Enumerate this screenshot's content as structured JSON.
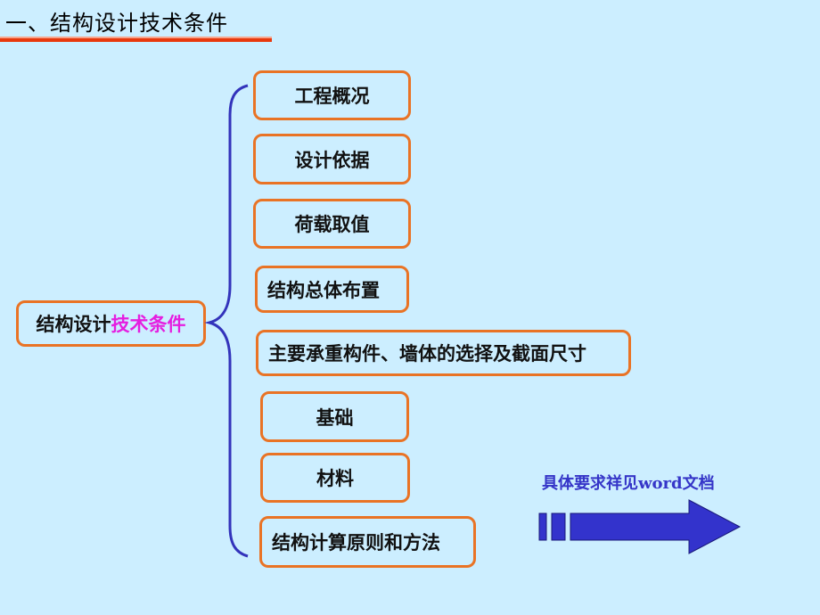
{
  "slide": {
    "title": "一、结构设计技术条件",
    "root": {
      "label_plain": "结构设计",
      "label_highlight": "技术条件"
    },
    "items": [
      {
        "label": "工程概况"
      },
      {
        "label": "设计依据"
      },
      {
        "label": "荷载取值"
      },
      {
        "label": "结构总体布置"
      },
      {
        "label": "主要承重构件、墙体的选择及截面尺寸"
      },
      {
        "label": "基础"
      },
      {
        "label": "材料"
      },
      {
        "label": "结构计算原则和方法"
      }
    ],
    "note": "具体要求祥见word文档",
    "colors": {
      "background": "#cceeff",
      "box_border": "#e97325",
      "brace": "#3333bb",
      "highlight": "#e51ee0",
      "arrow": "#3333cc",
      "title_underline": "#e8380d"
    }
  }
}
